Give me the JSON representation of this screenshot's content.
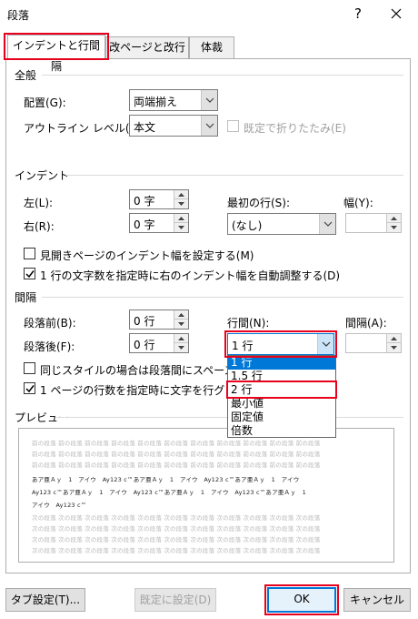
{
  "window": {
    "title": "段落",
    "help": "?",
    "close": "✕"
  },
  "tabs": [
    {
      "label": "インデントと行間隔"
    },
    {
      "label": "改ページと改行"
    },
    {
      "label": "体裁"
    }
  ],
  "general": {
    "title": "全般",
    "alignment_label": "配置(G):",
    "alignment_value": "両端揃え",
    "outline_label": "アウトライン レベル(O):",
    "outline_value": "本文",
    "collapsed_label": "既定で折りたたみ(E)"
  },
  "indent": {
    "title": "インデント",
    "left_label": "左(L):",
    "left_value": "0 字",
    "right_label": "右(R):",
    "right_value": "0 字",
    "first_line_label": "最初の行(S):",
    "first_line_value": "(なし)",
    "width_label": "幅(Y):",
    "width_value": "",
    "mirror_label": "見開きページのインデント幅を設定する(M)",
    "auto_adjust_label": "1 行の文字数を指定時に右のインデント幅を自動調整する(D)"
  },
  "spacing": {
    "title": "間隔",
    "before_label": "段落前(B):",
    "before_value": "0 行",
    "after_label": "段落後(F):",
    "after_value": "0 行",
    "line_spacing_label": "行間(N):",
    "line_spacing_value": "1 行",
    "at_label": "間隔(A):",
    "at_value": "",
    "no_space_label": "同じスタイルの場合は段落間にスペースを追",
    "snap_grid_label": "1 ページの行数を指定時に文字を行グリッド",
    "options": [
      "1 行",
      "1.5 行",
      "2 行",
      "最小値",
      "固定値",
      "倍数"
    ]
  },
  "preview": {
    "title": "プレビュー",
    "ghost_line": "前の段落 前の段落 前の段落 前の段落 前の段落 前の段落 前の段落 前の段落 前の段落 前の段落 前の段落",
    "sample_line1": "あア亜Ａｙ　1　アイウ　Ay123 c™あア亜Ａｙ　1　アイウ　Ay123 c™あア亜Ａｙ　1　アイウ",
    "sample_line2": "Ay123 c™あア亜Ａｙ　1　アイウ　Ay123 c™あア亜Ａｙ　1　アイウ　Ay123 c™あア亜Ａｙ　1",
    "sample_line3": "アイウ　Ay123 c™",
    "next_line": "次の段落 次の段落 次の段落 次の段落 次の段落 次の段落 次の段落 次の段落 次の段落 次の段落 次の段落"
  },
  "buttons": {
    "tabs": "タブ設定(T)...",
    "set_default": "既定に設定(D)",
    "ok": "OK",
    "cancel": "キャンセル"
  },
  "colors": {
    "highlight": "#e8001c",
    "accent": "#0078d7"
  }
}
